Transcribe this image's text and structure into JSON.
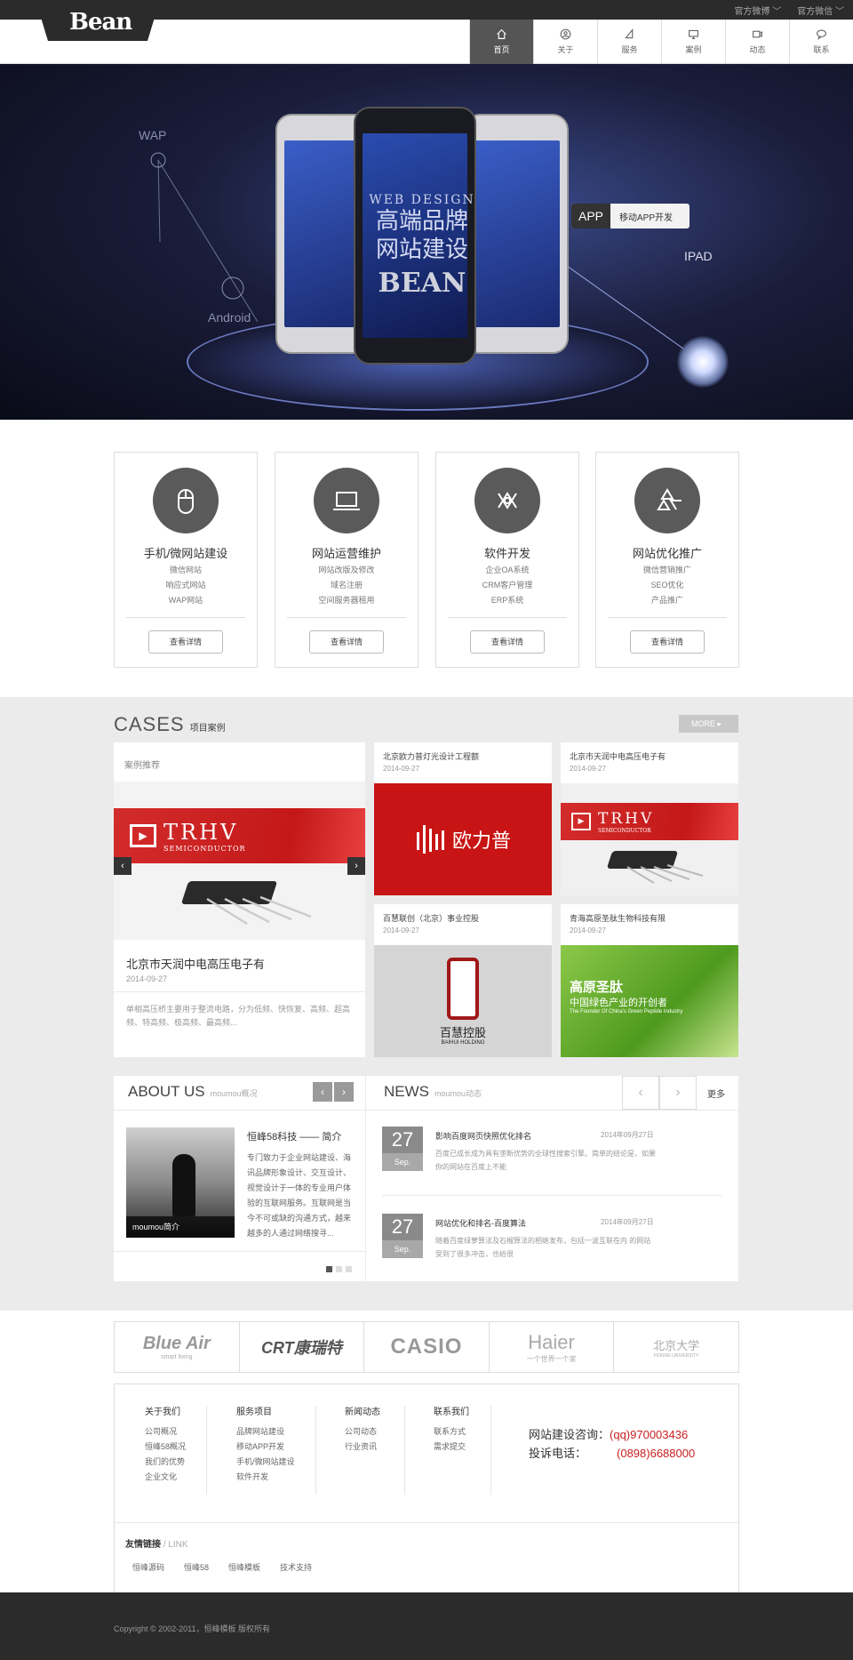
{
  "topbar": {
    "weibo": "官方微博 ﹀",
    "wechat": "官方微信 ﹀"
  },
  "logo": "Bean",
  "nav": [
    {
      "label": "首页",
      "icon": "home-icon",
      "active": true
    },
    {
      "label": "关于",
      "icon": "user-icon"
    },
    {
      "label": "服务",
      "icon": "send-icon"
    },
    {
      "label": "案例",
      "icon": "monitor-icon"
    },
    {
      "label": "动态",
      "icon": "video-icon"
    },
    {
      "label": "联系",
      "icon": "chat-icon"
    }
  ],
  "banner": {
    "wap": "WAP",
    "android": "Android",
    "ipad": "IPAD",
    "app_tag": "APP",
    "app_text": "移动APP开发",
    "line1": "WEB DESIGN",
    "line2": "高端品牌",
    "line3": "网站建设",
    "line4": "BEAN"
  },
  "services": [
    {
      "title": "手机/微网站建设",
      "icon": "mouse-icon",
      "items": [
        "微信网站",
        "响应式网站",
        "WAP网站"
      ],
      "button": "查看详情"
    },
    {
      "title": "网站运营维护",
      "icon": "laptop-icon",
      "items": [
        "网站改版及修改",
        "域名注册",
        "空间服务器租用"
      ],
      "button": "查看详情"
    },
    {
      "title": "软件开发",
      "icon": "code-icon",
      "items": [
        "企业OA系统",
        "CRM客户管理",
        "ERP系统"
      ],
      "button": "查看详情"
    },
    {
      "title": "网站优化推广",
      "icon": "recycle-icon",
      "items": [
        "微信营销推广",
        "SEO优化",
        "产品推广"
      ],
      "button": "查看详情"
    }
  ],
  "cases": {
    "title_en": "CASES",
    "title_cn": "项目案例",
    "more": "MORE ▸",
    "featured": {
      "header": "案例推荐",
      "brand": "TRHV",
      "brand_sub": "SEMICONDUCTOR",
      "title": "北京市天润中电高压电子有",
      "date": "2014-09-27",
      "desc": "单相高压桥主要用于整流电路，分为低频、快恢复、高频、超高频、特高频、极高频、最高频..."
    },
    "items": [
      {
        "title": "北京欧力普灯光设计工程额",
        "date": "2014-09-27",
        "logo": "欧力普"
      },
      {
        "title": "北京市天润中电高压电子有",
        "date": "2014-09-27",
        "logo": "TRHV",
        "logo_sub": "SEMICONDUCTOR"
      },
      {
        "title": "百慧联创（北京）事业控股",
        "date": "2014-09-27",
        "logo": "百慧控股",
        "logo_sub": "BAIHUI HOLDING"
      },
      {
        "title": "青海高原圣肽生物科技有限",
        "date": "2014-09-27",
        "logo": "高原圣肽",
        "logo_sub": "中国绿色产业的开创者",
        "logo_sub2": "The Founder Of China's Green Peptide Industry"
      }
    ]
  },
  "about": {
    "title": "ABOUT US",
    "sub": "moumou概况",
    "caption": "moumou简介",
    "heading": "恒峰58科技 —— 简介",
    "text": "专门致力于企业网站建设、海讯品牌形象设计、交互设计、视觉设计于一体的专业用户体验的互联网服务。互联网是当今不可或缺的沟通方式，越来越多的人通过网络搜寻..."
  },
  "news": {
    "title": "NEWS",
    "sub": "moumou动态",
    "more": "更多",
    "items": [
      {
        "day": "27",
        "month": "Sep.",
        "title": "影响百度网页快照优化排名",
        "date": "2014年09月27日",
        "text": "百度已成长成为具有垄断优势的全球性搜索引擎。简单的结论是，如果你的网站在百度上不能"
      },
      {
        "day": "27",
        "month": "Sep.",
        "title": "网站优化和排名-百度算法",
        "date": "2014年09月27日",
        "text": "随着百度绿萝算法及石榴算法的相继发布，包括一波互联在内 的网站受到了很多冲击，也给很"
      }
    ]
  },
  "partners": [
    {
      "name": "Blue Air",
      "sub": "smart living"
    },
    {
      "name": "CRT康瑞特"
    },
    {
      "name": "CASIO"
    },
    {
      "name": "Haier",
      "sub": "一个世界一个家"
    },
    {
      "name": "北京大学",
      "sub": "PEKING UNIVERSITY"
    }
  ],
  "footer": {
    "cols": [
      {
        "head": "关于我们",
        "items": [
          "公司概况",
          "恒峰58概况",
          "我们的优势",
          "企业文化"
        ]
      },
      {
        "head": "服务项目",
        "items": [
          "品牌网站建设",
          "移动APP开发",
          "手机/微网站建设",
          "软件开发"
        ]
      },
      {
        "head": "新闻动态",
        "items": [
          "公司动态",
          "行业资讯"
        ]
      },
      {
        "head": "联系我们",
        "items": [
          "联系方式",
          "需求提交"
        ]
      }
    ],
    "contact1_label": "网站建设咨询：",
    "contact1_value": "(qq)970003436",
    "contact2_label": "投诉电话：",
    "contact2_value": "(0898)6688000",
    "links_head": "友情链接",
    "links_head_en": " / LINK",
    "links": [
      "恒峰源码",
      "恒峰58",
      "恒峰模板",
      "技术支持"
    ]
  },
  "copyright": "Copyright © 2002-2011，恒峰模板 版权所有"
}
